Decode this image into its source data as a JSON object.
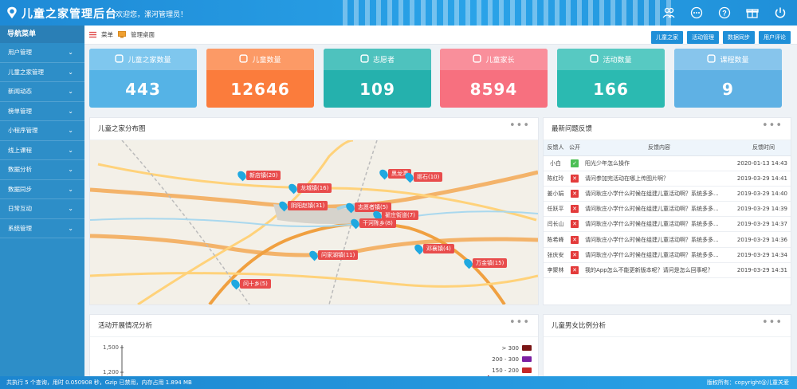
{
  "header": {
    "title": "儿童之家管理后台",
    "welcome": "欢迎您，漯河管理员！",
    "icons": [
      "users-icon",
      "chat-icon",
      "help-icon",
      "gift-icon",
      "power-icon"
    ]
  },
  "sidebar": {
    "title": "导航菜单",
    "items": [
      {
        "label": "用户管理"
      },
      {
        "label": "儿童之家管理"
      },
      {
        "label": "新闻动态"
      },
      {
        "label": "榜单管理"
      },
      {
        "label": "小程序管理"
      },
      {
        "label": "线上课程"
      },
      {
        "label": "数据分析"
      },
      {
        "label": "数据同步"
      },
      {
        "label": "日常互动"
      },
      {
        "label": "系统管理"
      }
    ]
  },
  "breadcrumb": {
    "menu": "菜单",
    "page": "管理桌面"
  },
  "toolbar": [
    "儿童之家",
    "活动管理",
    "数据同步",
    "用户评论"
  ],
  "stats": [
    {
      "label": "儿童之家数量",
      "value": "443",
      "color": "#55b3e6",
      "head": "#7fc7ee"
    },
    {
      "label": "儿童数量",
      "value": "12646",
      "color": "#fb7c3c",
      "head": "#fc9a66"
    },
    {
      "label": "志愿者",
      "value": "109",
      "color": "#25b1ad",
      "head": "#4ec2be"
    },
    {
      "label": "儿童家长",
      "value": "8594",
      "color": "#f7707f",
      "head": "#f98f9b"
    },
    {
      "label": "活动数量",
      "value": "166",
      "color": "#2bbab1",
      "head": "#57c9c2"
    },
    {
      "label": "课程数量",
      "value": "9",
      "color": "#5fb1e4",
      "head": "#87c5ec"
    }
  ],
  "map_panel": {
    "title": "儿童之家分布图",
    "markers": [
      {
        "label": "新店镇(20)"
      },
      {
        "label": "黑龙潭"
      },
      {
        "label": "龙城镇(16)"
      },
      {
        "label": "姬石(10)"
      },
      {
        "label": "阴阳赵镇(31)"
      },
      {
        "label": "志愿者镇(5)"
      },
      {
        "label": "翟庄街道(7)"
      },
      {
        "label": "干河陈乡(8)"
      },
      {
        "label": "邓襄镇(4)"
      },
      {
        "label": "问家湖镇(11)"
      },
      {
        "label": "万金镇(15)"
      },
      {
        "label": "问十乡(5)"
      }
    ]
  },
  "feedback_panel": {
    "title": "最新问题反馈",
    "columns": [
      "反馈人",
      "公开",
      "反馈内容",
      "反馈时间"
    ],
    "rows": [
      {
        "user": "小白",
        "open": true,
        "content": "阳光少年怎么操作",
        "time": "2020-01-13 14:43"
      },
      {
        "user": "陈红玲",
        "open": false,
        "content": "请问参加完活动在哪上传图片啊？",
        "time": "2019-03-29 14:41"
      },
      {
        "user": "姜小娟",
        "open": false,
        "content": "请问耿庄小学什么时候在组建儿童活动啊？系统多多...",
        "time": "2019-03-29 14:40"
      },
      {
        "user": "任跃平",
        "open": false,
        "content": "请问耿庄小学什么时候在组建儿童活动啊？系统多多...",
        "time": "2019-03-29 14:39"
      },
      {
        "user": "闫长山",
        "open": false,
        "content": "请问耿庄小学什么时候在组建儿童活动啊？系统多多...",
        "time": "2019-03-29 14:37"
      },
      {
        "user": "陈希峰",
        "open": false,
        "content": "请问耿庄小学什么时候在组建儿童活动啊？系统多多...",
        "time": "2019-03-29 14:36"
      },
      {
        "user": "张庆安",
        "open": false,
        "content": "请问耿庄小学什么时候在组建儿童活动啊？系统多多...",
        "time": "2019-03-29 14:34"
      },
      {
        "user": "李聚林",
        "open": false,
        "content": "我的App怎么不能更新版本呢？请问是怎么回事呢？",
        "time": "2019-03-29 14:31"
      }
    ]
  },
  "activity_panel": {
    "title": "活动开展情况分析",
    "yticks": [
      "1,500",
      "1,200"
    ],
    "legend": [
      "> 300",
      "200 - 300",
      "150 - 200"
    ],
    "legend_colors": [
      "#7a1616",
      "#7b1fa2",
      "#c62828"
    ]
  },
  "gender_panel": {
    "title": "儿童男女比例分析"
  },
  "footer": {
    "left": "共执行 5 个查询，用时 0.050908 秒，Gzip 已禁用，内存占用 1.894 MB",
    "right": "版权所有：copyright@儿童关爱"
  }
}
